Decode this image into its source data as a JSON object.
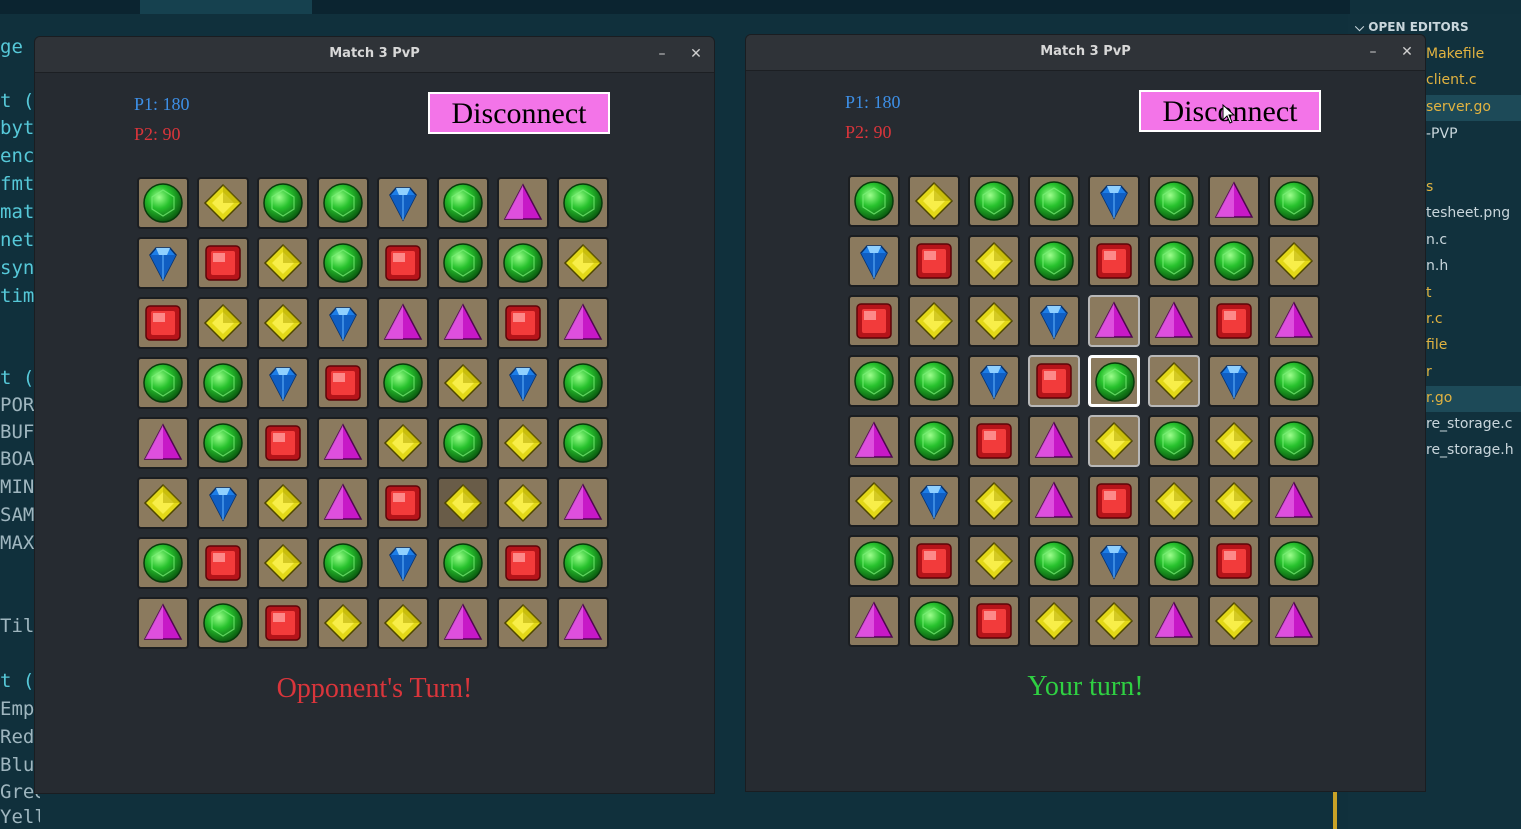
{
  "background": {
    "code_lines": [
      {
        "text": "ge",
        "color": "#56c8d8"
      },
      {
        "text": "t (",
        "color": "#56c8d8"
      },
      {
        "text": "byt",
        "color": "#56c8d8"
      },
      {
        "text": "enc",
        "color": "#56c8d8"
      },
      {
        "text": "fmt",
        "color": "#56c8d8"
      },
      {
        "text": "mat",
        "color": "#56c8d8"
      },
      {
        "text": "net",
        "color": "#56c8d8"
      },
      {
        "text": "syn",
        "color": "#56c8d8"
      },
      {
        "text": "tim",
        "color": "#56c8d8"
      },
      {
        "text": "t (",
        "color": "#56c8d8"
      },
      {
        "text": "PORT",
        "color": "#9fb6bf"
      },
      {
        "text": "BUFL",
        "color": "#9fb6bf"
      },
      {
        "text": "BOAR",
        "color": "#9fb6bf"
      },
      {
        "text": "MIN_",
        "color": "#9fb6bf"
      },
      {
        "text": "SAME",
        "color": "#9fb6bf"
      },
      {
        "text": "MAX_",
        "color": "#9fb6bf"
      },
      {
        "text": "Til",
        "color": "#9fb6bf"
      },
      {
        "text": "t (",
        "color": "#56c8d8"
      },
      {
        "text": "Empt",
        "color": "#9fb6bf"
      },
      {
        "text": "Red",
        "color": "#9fb6bf"
      },
      {
        "text": "Blue",
        "color": "#9fb6bf"
      },
      {
        "text": "Green",
        "color": "#9fb6bf"
      },
      {
        "text": "Yellow",
        "color": "#9fb6bf"
      }
    ],
    "explorer_header": "OPEN EDITORS",
    "files": [
      {
        "text": "Makefile",
        "color": "#e2b340"
      },
      {
        "text": "client.c",
        "color": "#e2b340"
      },
      {
        "text": "server.go",
        "color": "#e2b340"
      },
      {
        "text": "-PVP",
        "color": "#c9d6dc"
      },
      {
        "text": "s",
        "color": "#e2b340"
      },
      {
        "text": "tesheet.png",
        "color": "#c9d6dc"
      },
      {
        "text": "n.c",
        "color": "#c9d6dc"
      },
      {
        "text": "n.h",
        "color": "#c9d6dc"
      },
      {
        "text": "t",
        "color": "#e2b340"
      },
      {
        "text": "r.c",
        "color": "#e2b340"
      },
      {
        "text": "file",
        "color": "#e2b340"
      },
      {
        "text": "r",
        "color": "#e2b340"
      },
      {
        "text": "r.go",
        "color": "#e2b340"
      },
      {
        "text": "re_storage.c",
        "color": "#c9d6dc"
      },
      {
        "text": "re_storage.h",
        "color": "#c9d6dc"
      }
    ]
  },
  "windows": [
    {
      "title": "Match 3 PvP",
      "minimize": "–",
      "close": "✕",
      "p1": "P1: 180",
      "p2": "P2: 90",
      "button": "Disconnect",
      "turn_text": "Opponent's Turn!",
      "turn_color": "#d9353b",
      "board": [
        [
          "G",
          "Y",
          "G",
          "G",
          "B",
          "G",
          "P",
          "G"
        ],
        [
          "B",
          "R",
          "Y",
          "G",
          "R",
          "G",
          "G",
          "Y"
        ],
        [
          "R",
          "Y",
          "Y",
          "B",
          "P",
          "P",
          "R",
          "P"
        ],
        [
          "G",
          "G",
          "B",
          "R",
          "G",
          "Y",
          "B",
          "G"
        ],
        [
          "P",
          "G",
          "R",
          "P",
          "Y",
          "G",
          "Y",
          "G"
        ],
        [
          "Y",
          "B",
          "Y",
          "P",
          "R",
          "Y",
          "Y",
          "P"
        ],
        [
          "G",
          "R",
          "Y",
          "G",
          "B",
          "G",
          "R",
          "G"
        ],
        [
          "P",
          "G",
          "R",
          "Y",
          "Y",
          "P",
          "Y",
          "P"
        ]
      ],
      "dim_cells": [
        [
          5,
          5
        ]
      ],
      "highlight_cells": [],
      "selected_cells": []
    },
    {
      "title": "Match 3 PvP",
      "minimize": "–",
      "close": "✕",
      "p1": "P1: 180",
      "p2": "P2: 90",
      "button": "Disconnect",
      "turn_text": "Your turn!",
      "turn_color": "#2fd042",
      "board": [
        [
          "G",
          "Y",
          "G",
          "G",
          "B",
          "G",
          "P",
          "G"
        ],
        [
          "B",
          "R",
          "Y",
          "G",
          "R",
          "G",
          "G",
          "Y"
        ],
        [
          "R",
          "Y",
          "Y",
          "B",
          "P",
          "P",
          "R",
          "P"
        ],
        [
          "G",
          "G",
          "B",
          "R",
          "G",
          "Y",
          "B",
          "G"
        ],
        [
          "P",
          "G",
          "R",
          "P",
          "Y",
          "G",
          "Y",
          "G"
        ],
        [
          "Y",
          "B",
          "Y",
          "P",
          "R",
          "Y",
          "Y",
          "P"
        ],
        [
          "G",
          "R",
          "Y",
          "G",
          "B",
          "G",
          "R",
          "G"
        ],
        [
          "P",
          "G",
          "R",
          "Y",
          "Y",
          "P",
          "Y",
          "P"
        ]
      ],
      "dim_cells": [],
      "highlight_cells": [
        [
          2,
          4
        ],
        [
          3,
          3
        ],
        [
          3,
          5
        ],
        [
          4,
          4
        ]
      ],
      "selected_cells": [
        [
          3,
          4
        ]
      ]
    }
  ],
  "colors": {
    "p1": "#3d8fe6",
    "p2": "#d9353b",
    "button_bg": "#f374e8"
  }
}
